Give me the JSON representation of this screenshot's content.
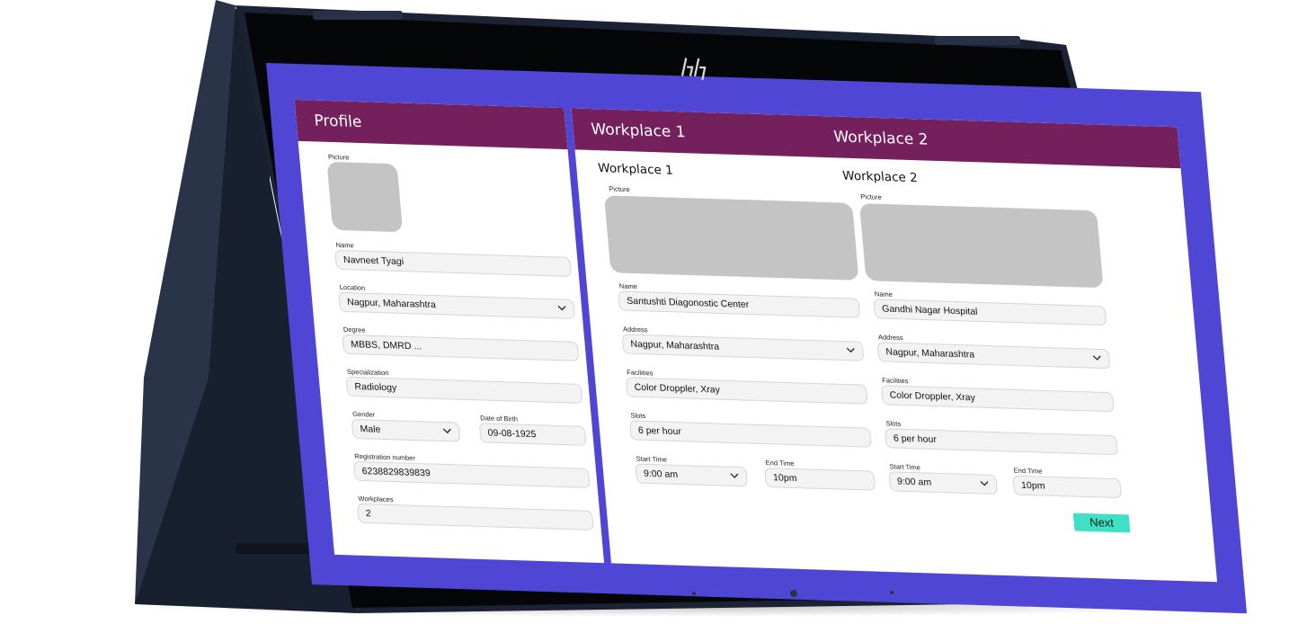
{
  "colors": {
    "screen_background": "#4f46d6",
    "header_background": "#73205c",
    "field_background": "#f3f3f3",
    "picture_placeholder": "#c4c4c4",
    "next_button": "#3ee0c6",
    "device_body": "#1e2638"
  },
  "icons": {
    "brand_logo": "hp-logo-icon",
    "dropdown": "chevron-down-icon"
  },
  "profile": {
    "title": "Profile",
    "picture_label": "Picture",
    "name": {
      "label": "Name",
      "value": "Navneet Tyagi"
    },
    "location": {
      "label": "Location",
      "value": "Nagpur, Maharashtra"
    },
    "degree": {
      "label": "Degree",
      "value": "MBBS, DMRD ..."
    },
    "specialization": {
      "label": "Specialization",
      "value": "Radiology"
    },
    "gender": {
      "label": "Gender",
      "value": "Male"
    },
    "dob": {
      "label": "Date of Birth",
      "value": "09-08-1925"
    },
    "registration": {
      "label": "Registration number",
      "value": "6238829839839"
    },
    "workplaces": {
      "label": "Workplaces",
      "value": "2"
    }
  },
  "workplaces_header": {
    "tab1": "Workplace 1",
    "tab2": "Workplace 2"
  },
  "workplace1": {
    "title": "Workplace 1",
    "picture_label": "Picture",
    "name": {
      "label": "Name",
      "value": "Santushti Diagonostic Center"
    },
    "address": {
      "label": "Address",
      "value": "Nagpur, Maharashtra"
    },
    "facilities": {
      "label": "Facilities",
      "value": "Color Droppler, Xray"
    },
    "slots": {
      "label": "Slots",
      "value": "6 per hour"
    },
    "start_time": {
      "label": "Start Time",
      "value": "9:00 am"
    },
    "end_time": {
      "label": "End Time",
      "value": "10pm"
    }
  },
  "workplace2": {
    "title": "Workplace 2",
    "picture_label": "Picture",
    "name": {
      "label": "Name",
      "value": "Gandhi Nagar Hospital"
    },
    "address": {
      "label": "Address",
      "value": "Nagpur, Maharashtra"
    },
    "facilities": {
      "label": "Facilities",
      "value": "Color Droppler, Xray"
    },
    "slots": {
      "label": "Slots",
      "value": "6 per hour"
    },
    "start_time": {
      "label": "Start Time",
      "value": "9:00 am"
    },
    "end_time": {
      "label": "End Time",
      "value": "10pm"
    }
  },
  "next_label": "Next"
}
